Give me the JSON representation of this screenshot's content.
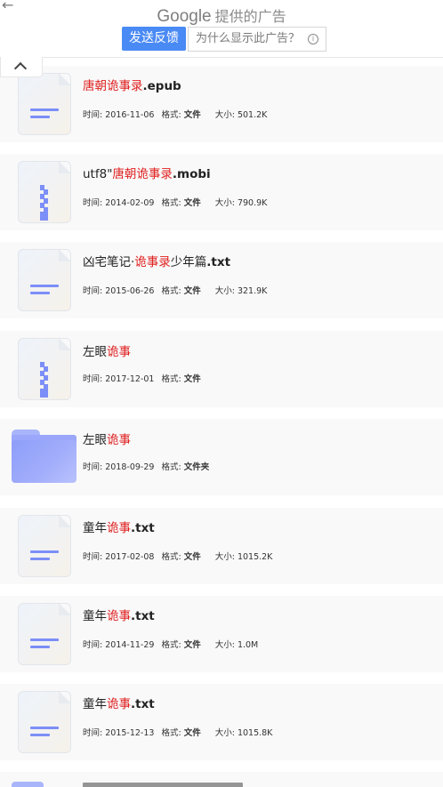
{
  "ad": {
    "back_icon": "arrow-left-icon",
    "brand": "Google",
    "title": "提供的广告",
    "feedback_label": "发送反馈",
    "why_label": "为什么显示此广告？",
    "info_icon": "info-circle-icon",
    "accent_color": "#4a8af4"
  },
  "collapse_icon": "chevron-up-icon",
  "labels": {
    "time": "时间:",
    "format": "格式:",
    "size": "大小:"
  },
  "files": [
    {
      "name_pre": "",
      "name_hl": "唐朝诡事录",
      "name_post": "",
      "ext": ".epub",
      "date": "2016-11-06",
      "format": "文件",
      "size": "501.2K",
      "icon": "document-icon"
    },
    {
      "name_pre": "utf8\"",
      "name_hl": "唐朝诡事录",
      "name_post": "",
      "ext": ".mobi",
      "date": "2014-02-09",
      "format": "文件",
      "size": "790.9K",
      "icon": "zip-archive-icon"
    },
    {
      "name_pre": "凶宅笔记·",
      "name_hl": "诡事录",
      "name_post": "少年篇",
      "ext": ".txt",
      "date": "2015-06-26",
      "format": "文件",
      "size": "321.9K",
      "icon": "document-icon"
    },
    {
      "name_pre": "左眼",
      "name_hl": "诡事",
      "name_post": "",
      "ext": "",
      "date": "2017-12-01",
      "format": "文件",
      "size": "",
      "icon": "zip-archive-icon"
    },
    {
      "name_pre": "左眼",
      "name_hl": "诡事",
      "name_post": "",
      "ext": "",
      "date": "2018-09-29",
      "format": "文件夹",
      "size": "",
      "icon": "folder-icon"
    },
    {
      "name_pre": "童年",
      "name_hl": "诡事",
      "name_post": "",
      "ext": ".txt",
      "date": "2017-02-08",
      "format": "文件",
      "size": "1015.2K",
      "icon": "document-icon"
    },
    {
      "name_pre": "童年",
      "name_hl": "诡事",
      "name_post": "",
      "ext": ".txt",
      "date": "2014-11-29",
      "format": "文件",
      "size": "1.0M",
      "icon": "document-icon"
    },
    {
      "name_pre": "童年",
      "name_hl": "诡事",
      "name_post": "",
      "ext": ".txt",
      "date": "2015-12-13",
      "format": "文件",
      "size": "1015.8K",
      "icon": "document-icon"
    }
  ],
  "highlight_color": "#e02020"
}
